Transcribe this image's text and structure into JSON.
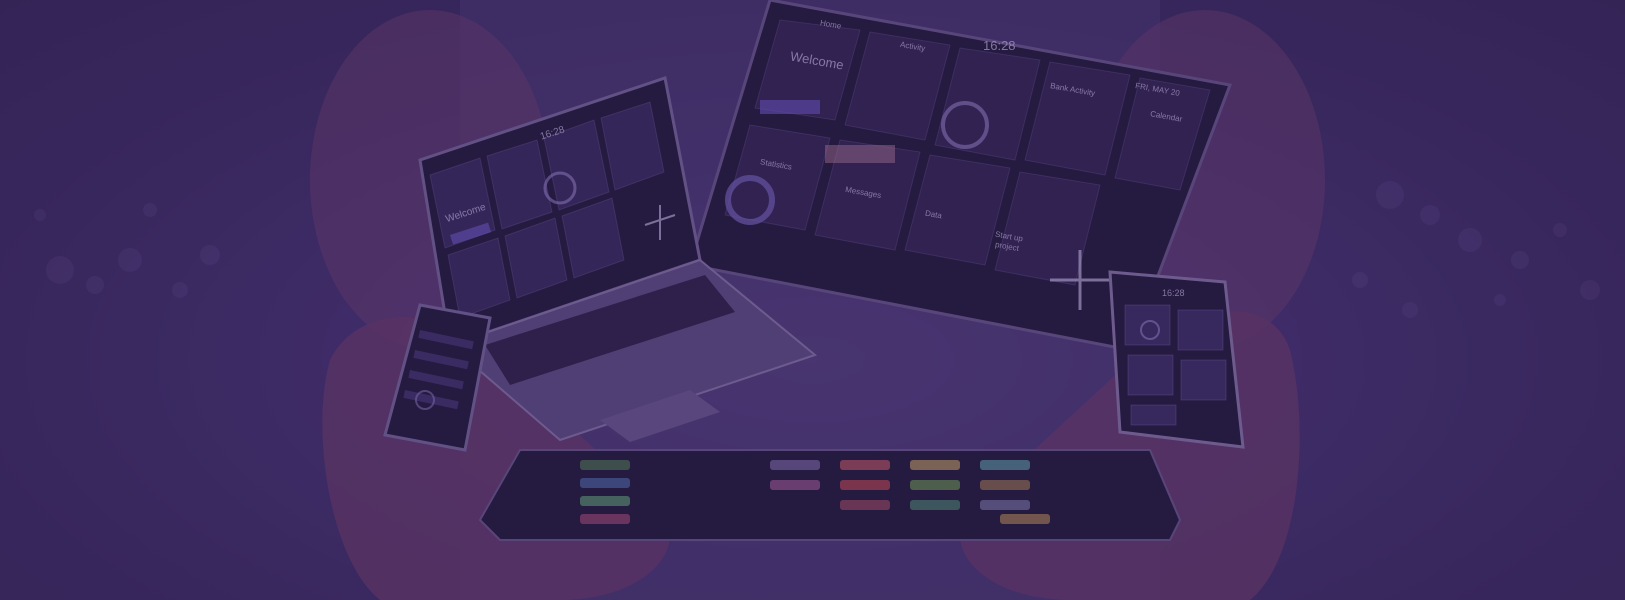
{
  "image": {
    "alt": "Hands holding floating devices: a laptop, a tablet monitor, phones and a tablet showing dashboard interfaces",
    "overlay_color": "#3a2a5e"
  },
  "tablet": {
    "time": "16:28",
    "date": "FRI, MAY 20",
    "welcome": "Welcome",
    "home": "Home",
    "activity": "Activity",
    "statistics": "Statistics",
    "data": "Data",
    "startup": "Start up",
    "project": "project",
    "bank_activity": "Bank Activity",
    "messages": "Messages",
    "calendar": "Calendar"
  },
  "laptop": {
    "time": "16:28",
    "welcome": "Welcome"
  },
  "small_tablet": {
    "time": "16:28"
  },
  "colors": {
    "background": "#3a2a5e",
    "accent_purple": "#7b5bd6",
    "device_dark": "#1d1630"
  }
}
